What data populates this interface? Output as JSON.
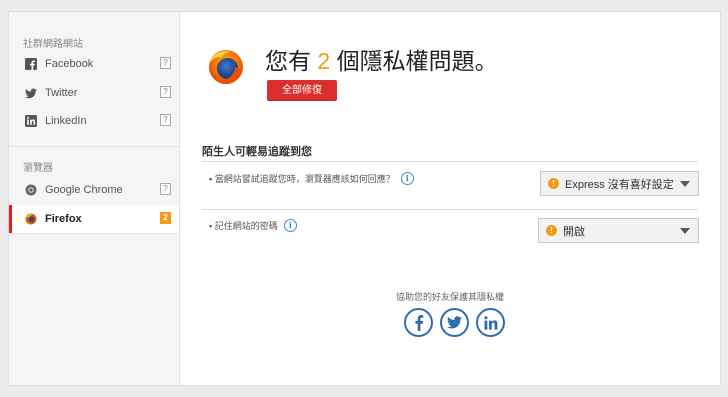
{
  "sidebar": {
    "social_title": "社群網路網站",
    "social_items": [
      {
        "label": "Facebook",
        "badge": "?"
      },
      {
        "label": "Twitter",
        "badge": "?"
      },
      {
        "label": "LinkedIn",
        "badge": "?"
      }
    ],
    "browser_title": "瀏覽器",
    "browser_items": [
      {
        "label": "Google Chrome",
        "badge": "?"
      },
      {
        "label": "Firefox",
        "badge": "2"
      }
    ]
  },
  "main": {
    "headline_prefix": "您有",
    "issue_count": "2",
    "headline_suffix": "個隱私權問題。",
    "fix_button": "全部修復",
    "section_title": "陌生人可輕易追蹤到您",
    "questions": [
      {
        "text": "當網站嘗試追蹤您時，瀏覽器應該如何回應？",
        "selected": "Express 沒有喜好設定",
        "warning": true
      },
      {
        "text": "記住網站的密碼",
        "selected": "開啟",
        "warning": true
      }
    ],
    "share_text": "協助您的好友保護其隱私權"
  },
  "colors": {
    "accent_red": "#d9302f",
    "warning_orange": "#f39c12",
    "social_blue": "#2f6bb0",
    "info_blue": "#3a8ad9"
  }
}
